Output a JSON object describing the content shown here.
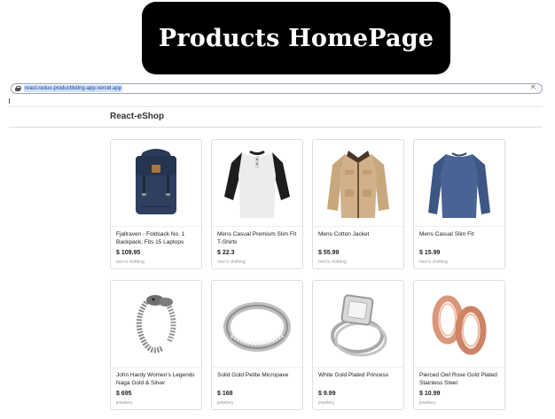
{
  "banner": {
    "title": "Products HomePage"
  },
  "browser": {
    "url": "react-redux-productlisting-app.vercel.app"
  },
  "header": {
    "brand": "React-eShop"
  },
  "products": [
    {
      "title": "Fjallraven - Foldsack No. 1 Backpack, Fits 15 Laptops",
      "price": "$ 109.95",
      "category": "men's clothing",
      "image_icon": "backpack-icon"
    },
    {
      "title": "Mens Casual Premium Slim Fit T-Shirts",
      "price": "$ 22.3",
      "category": "men's clothing",
      "image_icon": "raglan-tshirt-icon"
    },
    {
      "title": "Mens Cotton Jacket",
      "price": "$ 55.99",
      "category": "men's clothing",
      "image_icon": "jacket-icon"
    },
    {
      "title": "Mens Casual Slim Fit",
      "price": "$ 15.99",
      "category": "men's clothing",
      "image_icon": "long-sleeve-shirt-icon"
    },
    {
      "title": "John Hardy Women's Legends Naga Gold & Silver",
      "price": "$ 695",
      "category": "jewelery",
      "image_icon": "bracelet-icon"
    },
    {
      "title": "Solid Gold Petite Micropave",
      "price": "$ 168",
      "category": "jewelery",
      "image_icon": "ring-band-icon"
    },
    {
      "title": "White Gold Plated Princess",
      "price": "$ 9.99",
      "category": "jewelery",
      "image_icon": "diamond-ring-icon"
    },
    {
      "title": "Pierced Owl Rose Gold Plated Stainless Steel",
      "price": "$ 10.99",
      "category": "jewelery",
      "image_icon": "ear-tunnel-icon"
    }
  ]
}
